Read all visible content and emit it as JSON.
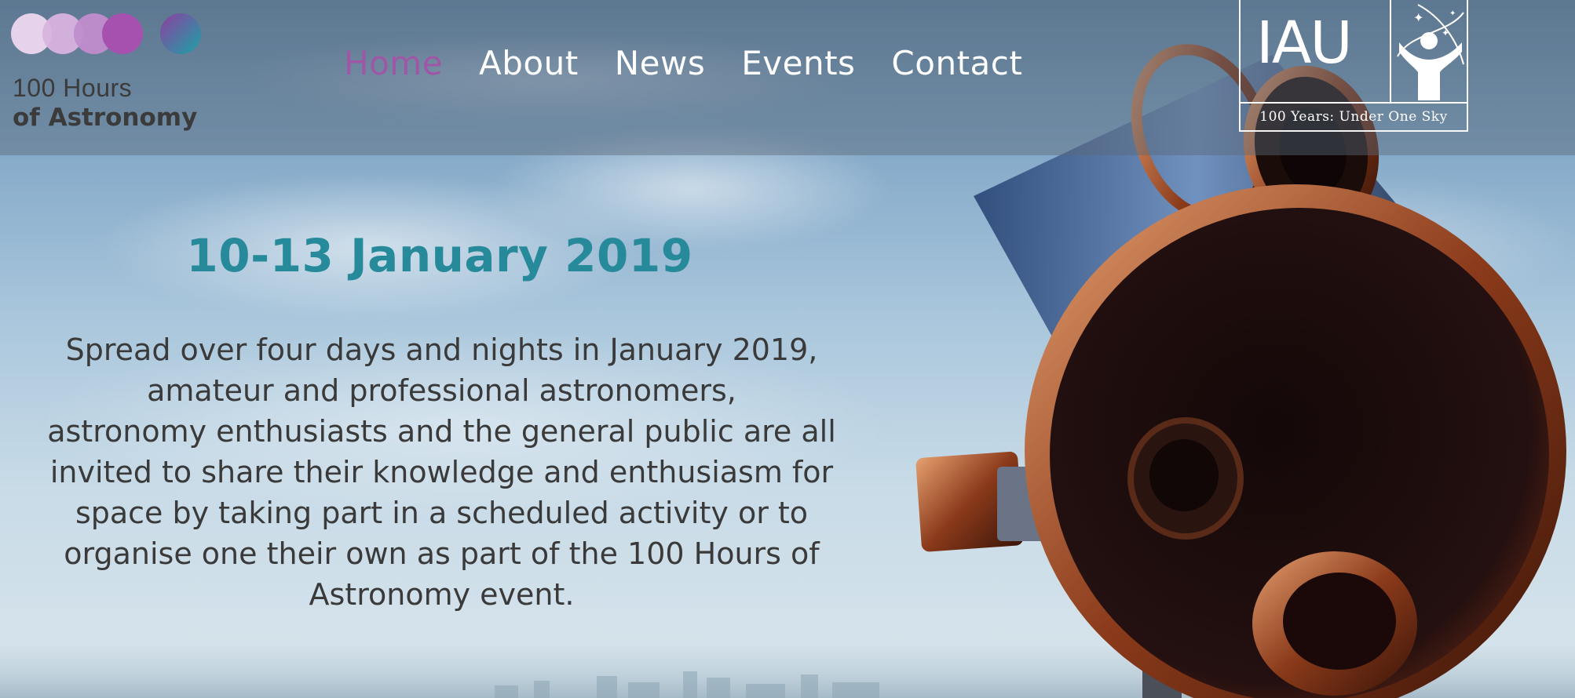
{
  "site": {
    "logo_line1": "100 Hours",
    "logo_line2": "of Astronomy"
  },
  "nav": {
    "items": [
      {
        "label": "Home",
        "active": true
      },
      {
        "label": "About",
        "active": false
      },
      {
        "label": "News",
        "active": false
      },
      {
        "label": "Events",
        "active": false
      },
      {
        "label": "Contact",
        "active": false
      }
    ]
  },
  "partner_logo": {
    "mark": "IAU",
    "tagline": "100 Years: Under One Sky"
  },
  "hero": {
    "date": "10-13 January 2019",
    "lines": [
      "Spread over four days and nights in January 2019,",
      "amateur and professional astronomers,",
      "astronomy enthusiasts and the general public are all",
      "invited to share their knowledge and enthusiasm for",
      "space by taking part in a scheduled activity or to",
      "organise one their own  as part of the 100 Hours of",
      "Astronomy event."
    ]
  },
  "colors": {
    "accent_active_nav": "#a056a6",
    "heading_teal": "#278a9a",
    "body_text": "#3a3a3a"
  },
  "icons": {
    "logo": "hundred-hours-circles-logo",
    "iau": "iau-emblem",
    "hero_image": "telescope-image"
  }
}
